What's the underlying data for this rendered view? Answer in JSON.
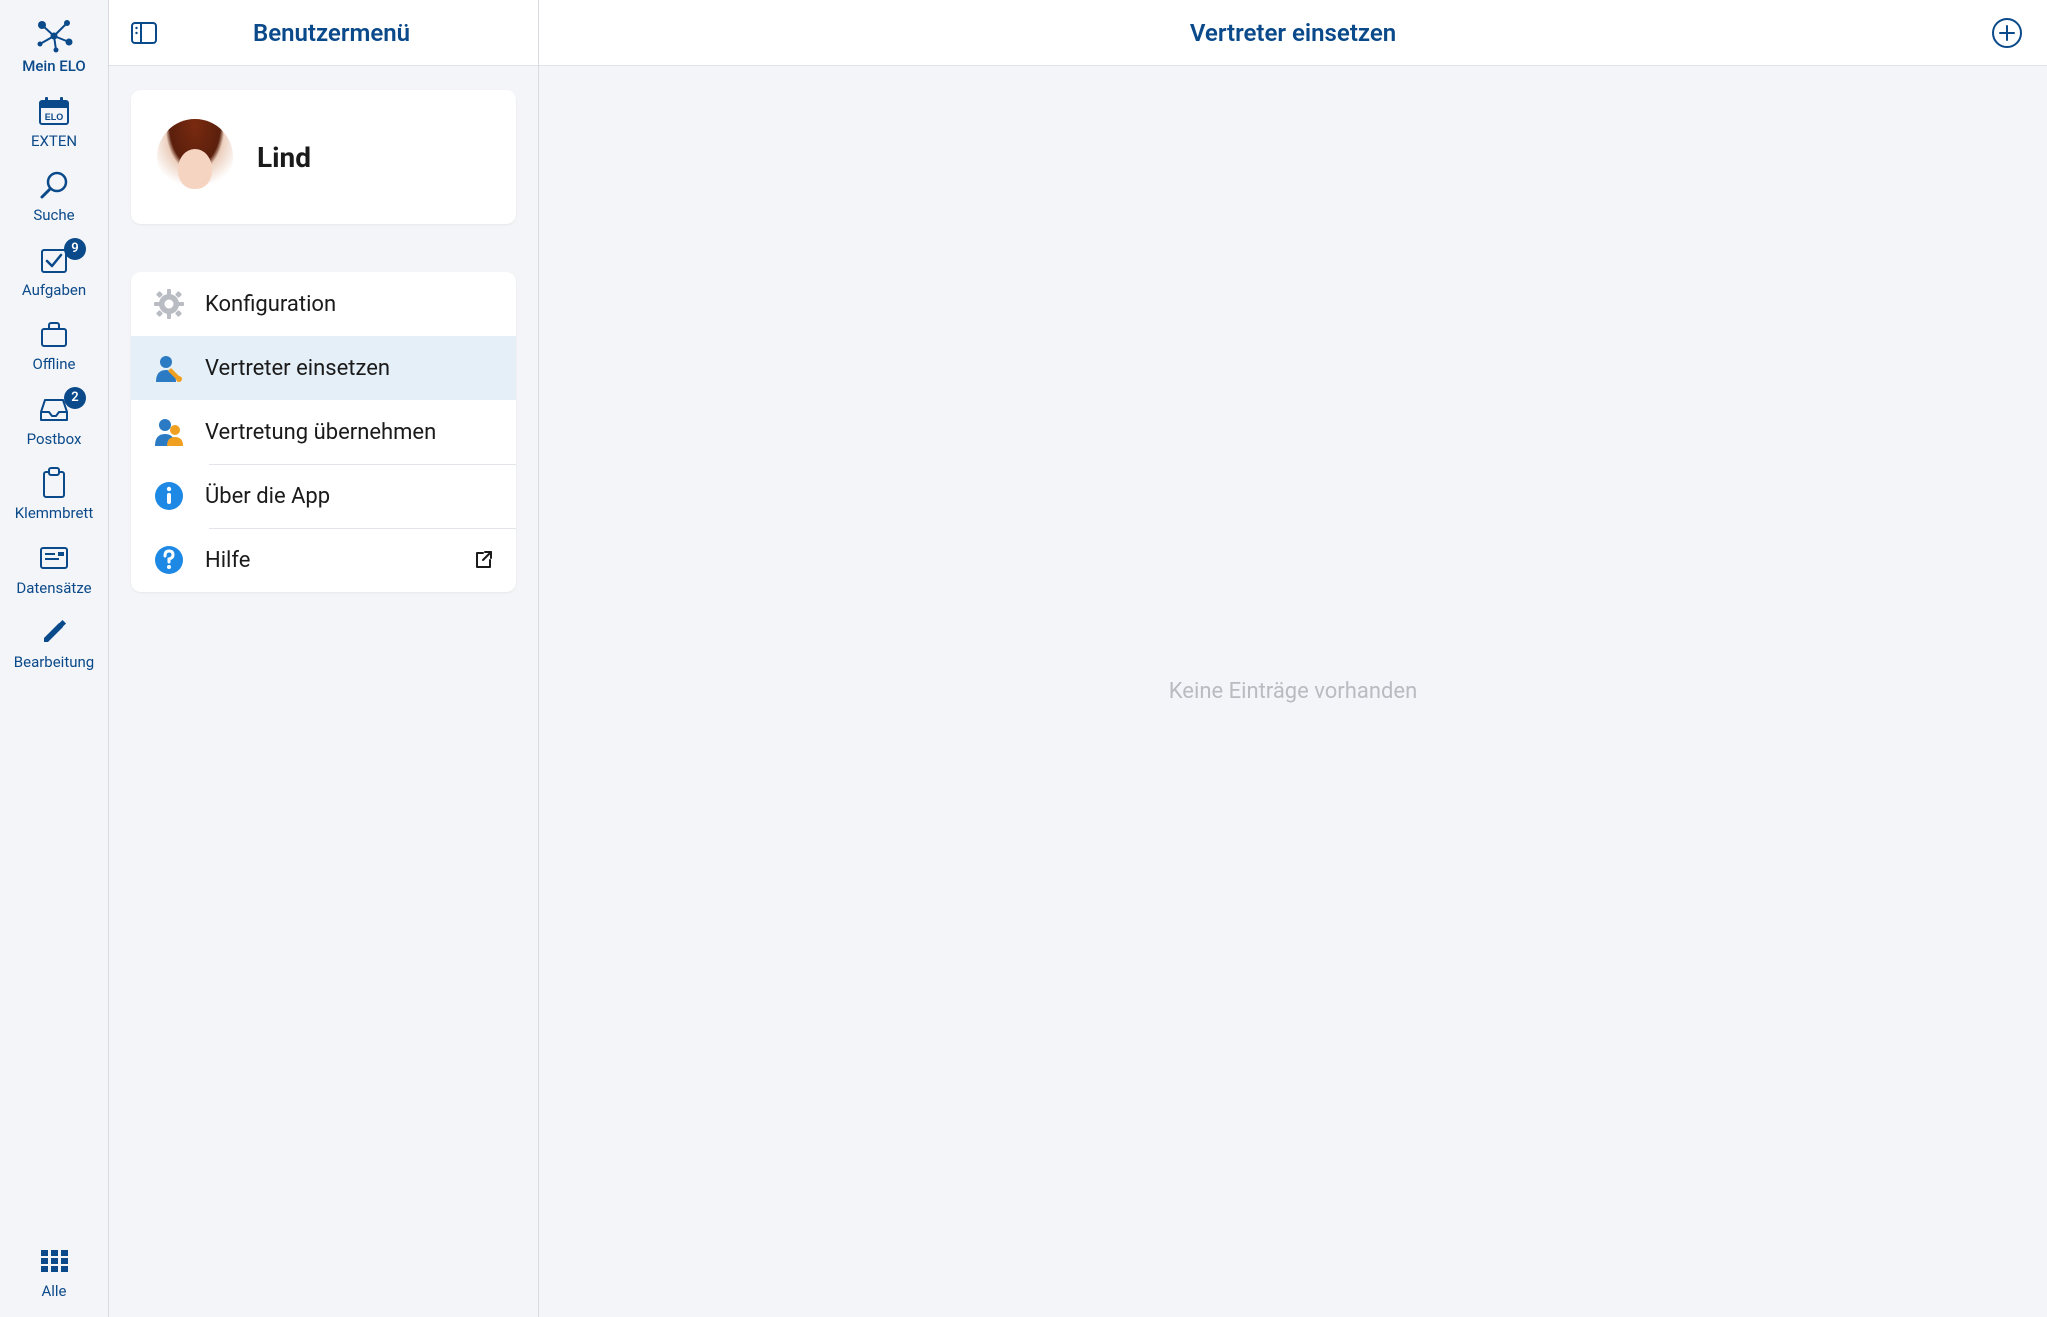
{
  "sidebar": {
    "items": [
      {
        "label": "Mein ELO"
      },
      {
        "label": "EXTEN"
      },
      {
        "label": "Suche"
      },
      {
        "label": "Aufgaben",
        "badge": "9"
      },
      {
        "label": "Offline"
      },
      {
        "label": "Postbox",
        "badge": "2"
      },
      {
        "label": "Klemmbrett"
      },
      {
        "label": "Datensätze"
      },
      {
        "label": "Bearbeitung"
      }
    ],
    "all_label": "Alle"
  },
  "mid": {
    "title": "Benutzermenü",
    "user": {
      "name": "Lind"
    },
    "menu": [
      {
        "label": "Konfiguration"
      },
      {
        "label": "Vertreter einsetzen"
      },
      {
        "label": "Vertretung übernehmen"
      },
      {
        "label": "Über die App"
      },
      {
        "label": "Hilfe"
      }
    ]
  },
  "right": {
    "title": "Vertreter einsetzen",
    "empty": "Keine Einträge vorhanden"
  }
}
